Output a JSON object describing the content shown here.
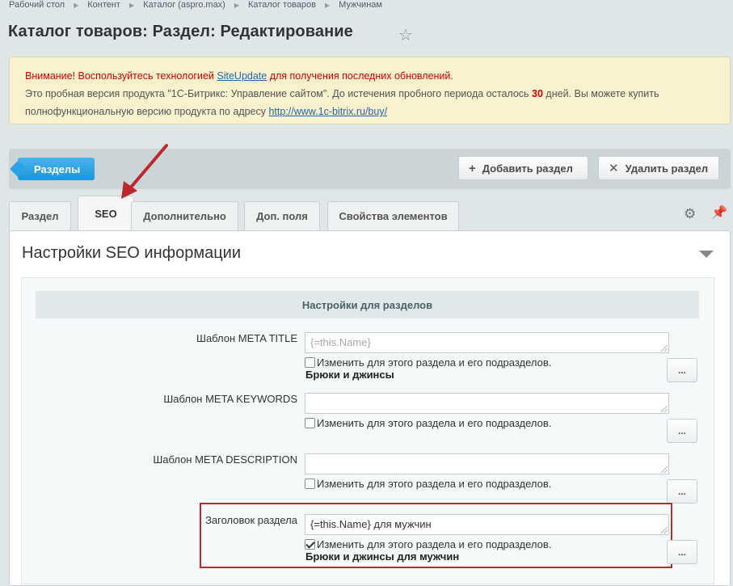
{
  "breadcrumb": [
    "Рабочий стол",
    "Контент",
    "Каталог (aspro.max)",
    "Каталог товаров",
    "Мужчинам"
  ],
  "page_title": "Каталог товаров: Раздел: Редактирование",
  "notice": {
    "warning_prefix": "Внимание! Воспользуйтесь технологией ",
    "warning_link": "SiteUpdate",
    "warning_suffix": " для получения последних обновлений.",
    "trial_text": "Это пробная версия продукта \"1С-Битрикс: Управление сайтом\". До истечения пробного периода осталось ",
    "days": "30",
    "trial_suffix": " дней. Вы можете купить полнофункциональную версию продукта по адресу ",
    "buy_link": "http://www.1c-bitrix.ru/buy/"
  },
  "toolbar": {
    "sections_label": "Разделы",
    "add_label": "Добавить раздел",
    "delete_label": "Удалить раздел"
  },
  "tabs": [
    "Раздел",
    "SEO",
    "Дополнительно",
    "Доп. поля",
    "Свойства элементов"
  ],
  "active_tab": "SEO",
  "section": {
    "title": "Настройки SEO информации",
    "subheader": "Настройки для разделов"
  },
  "fields": [
    {
      "label": "Шаблон META TITLE",
      "value": "",
      "placeholder": "{=this.Name}",
      "checkbox_label": "Изменить для этого раздела и его подразделов.",
      "checked": false,
      "result": "Брюки и джинсы"
    },
    {
      "label": "Шаблон META KEYWORDS",
      "value": "",
      "placeholder": "",
      "checkbox_label": "Изменить для этого раздела и его подразделов.",
      "checked": false,
      "result": ""
    },
    {
      "label": "Шаблон META DESCRIPTION",
      "value": "",
      "placeholder": "",
      "checkbox_label": "Изменить для этого раздела и его подразделов.",
      "checked": false,
      "result": ""
    },
    {
      "label": "Заголовок раздела",
      "value": "{=this.Name} для мужчин",
      "placeholder": "",
      "checkbox_label": "Изменить для этого раздела и его подразделов.",
      "checked": true,
      "result": "Брюки и джинсы для мужчин"
    }
  ],
  "dots_label": "...",
  "colors": {
    "accent_blue": "#1a96db",
    "highlight_red": "#c0272d",
    "warning_red": "#d40000"
  }
}
